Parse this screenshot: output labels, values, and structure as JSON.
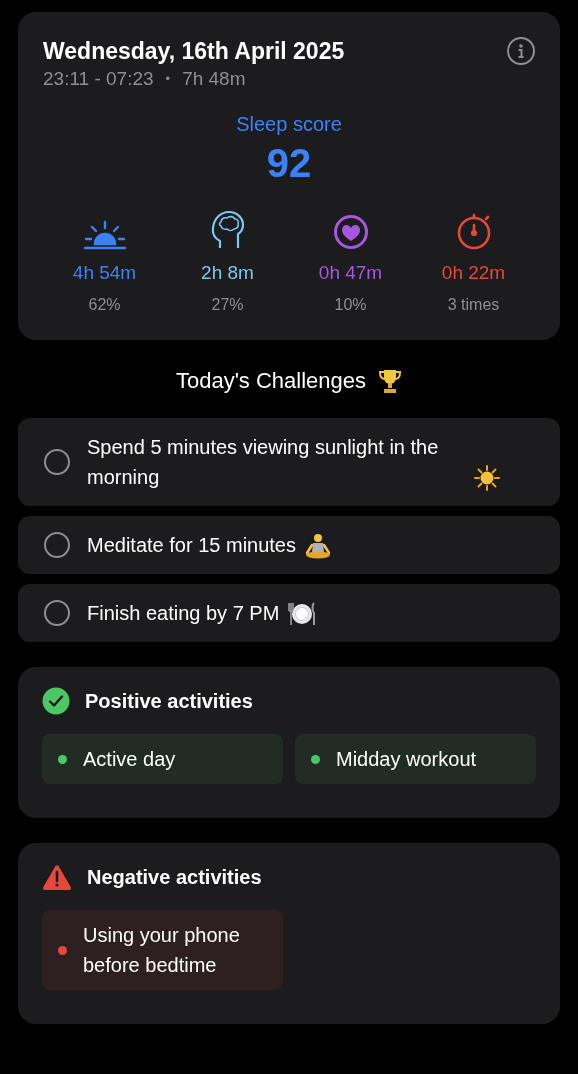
{
  "summary": {
    "date": "Wednesday, 16th April 2025",
    "time_range": "23:11 - 07:23",
    "separator": "•",
    "duration": "7h 48m",
    "score_label": "Sleep score",
    "score": "92",
    "stats": [
      {
        "kind": "sun",
        "color": "#3b82f6",
        "value": "4h 54m",
        "detail": "62%"
      },
      {
        "kind": "brain",
        "color": "#7dc8f0",
        "value": "2h 8m",
        "detail": "27%"
      },
      {
        "kind": "heart",
        "color": "#a855e0",
        "value": "0h 47m",
        "detail": "10%"
      },
      {
        "kind": "timer",
        "color": "#e5493a",
        "value": "0h 22m",
        "detail": "3 times"
      }
    ]
  },
  "challenges": {
    "title": "Today's Challenges",
    "items": [
      {
        "text": "Spend 5 minutes viewing sunlight in the morning",
        "kind": "sun",
        "checked": false
      },
      {
        "text": "Meditate for 15 minutes",
        "kind": "meditate",
        "checked": false
      },
      {
        "text": "Finish eating by 7 PM",
        "kind": "plate",
        "checked": false
      }
    ]
  },
  "activity_groups": [
    {
      "kind": "positive",
      "title": "Positive activities",
      "items": [
        "Active day",
        "Midday workout"
      ]
    },
    {
      "kind": "negative",
      "title": "Negative activities",
      "items": [
        "Using your phone before bedtime"
      ]
    }
  ]
}
